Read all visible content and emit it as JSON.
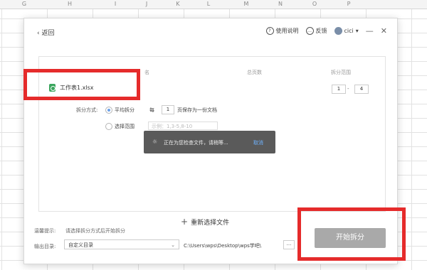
{
  "columns": [
    "G",
    "H",
    "I",
    "J",
    "K",
    "L",
    "M",
    "N",
    "O",
    "P"
  ],
  "titlebar": {
    "back_label": "返回",
    "help_label": "使用说明",
    "feedback_label": "反馈",
    "user_name": "cici",
    "minimize": "—",
    "close": "✕"
  },
  "table": {
    "col_name": "名",
    "col_pages": "总页数",
    "col_range": "拆分范围"
  },
  "file": {
    "name": "工作表1.xlsx",
    "range_from": "1",
    "range_dash": "-",
    "range_to": "4"
  },
  "split": {
    "mode_label": "拆分方式:",
    "average_label": "平均拆分",
    "every_label": "每",
    "every_value": "1",
    "per_doc_label": "页保存为一份文档",
    "select_range_label": "选择范围",
    "range_placeholder": "示例：1,3-5,8-10"
  },
  "toast": {
    "message": "正在为您检查文件，请稍等...",
    "cancel_label": "取消"
  },
  "reselect_label": "重新选择文件",
  "footer": {
    "tip_label": "温馨提示:",
    "tip_text": "请选择拆分方式后开始拆分",
    "output_label": "输出目录:",
    "output_select": "自定义目录",
    "output_path": "C:\\Users\\wps\\Desktop\\wps学吧\\",
    "more_button": "...",
    "start_button": "开始拆分"
  },
  "colors": {
    "highlight": "#e52b2b",
    "start_button_bg": "#a9a9a9",
    "radio_accent": "#6aa0e8",
    "toast_bg": "#5a5a5a"
  }
}
